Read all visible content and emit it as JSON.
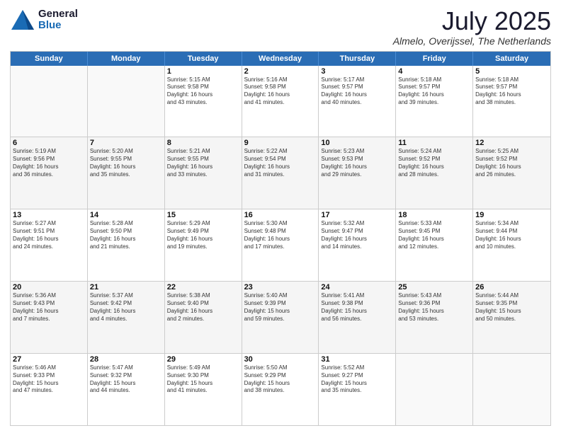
{
  "logo": {
    "general": "General",
    "blue": "Blue"
  },
  "title": "July 2025",
  "subtitle": "Almelo, Overijssel, The Netherlands",
  "header_days": [
    "Sunday",
    "Monday",
    "Tuesday",
    "Wednesday",
    "Thursday",
    "Friday",
    "Saturday"
  ],
  "rows": [
    [
      {
        "day": "",
        "lines": [],
        "empty": true
      },
      {
        "day": "",
        "lines": [],
        "empty": true
      },
      {
        "day": "1",
        "lines": [
          "Sunrise: 5:15 AM",
          "Sunset: 9:58 PM",
          "Daylight: 16 hours",
          "and 43 minutes."
        ]
      },
      {
        "day": "2",
        "lines": [
          "Sunrise: 5:16 AM",
          "Sunset: 9:58 PM",
          "Daylight: 16 hours",
          "and 41 minutes."
        ]
      },
      {
        "day": "3",
        "lines": [
          "Sunrise: 5:17 AM",
          "Sunset: 9:57 PM",
          "Daylight: 16 hours",
          "and 40 minutes."
        ]
      },
      {
        "day": "4",
        "lines": [
          "Sunrise: 5:18 AM",
          "Sunset: 9:57 PM",
          "Daylight: 16 hours",
          "and 39 minutes."
        ]
      },
      {
        "day": "5",
        "lines": [
          "Sunrise: 5:18 AM",
          "Sunset: 9:57 PM",
          "Daylight: 16 hours",
          "and 38 minutes."
        ]
      }
    ],
    [
      {
        "day": "6",
        "lines": [
          "Sunrise: 5:19 AM",
          "Sunset: 9:56 PM",
          "Daylight: 16 hours",
          "and 36 minutes."
        ]
      },
      {
        "day": "7",
        "lines": [
          "Sunrise: 5:20 AM",
          "Sunset: 9:55 PM",
          "Daylight: 16 hours",
          "and 35 minutes."
        ]
      },
      {
        "day": "8",
        "lines": [
          "Sunrise: 5:21 AM",
          "Sunset: 9:55 PM",
          "Daylight: 16 hours",
          "and 33 minutes."
        ]
      },
      {
        "day": "9",
        "lines": [
          "Sunrise: 5:22 AM",
          "Sunset: 9:54 PM",
          "Daylight: 16 hours",
          "and 31 minutes."
        ]
      },
      {
        "day": "10",
        "lines": [
          "Sunrise: 5:23 AM",
          "Sunset: 9:53 PM",
          "Daylight: 16 hours",
          "and 29 minutes."
        ]
      },
      {
        "day": "11",
        "lines": [
          "Sunrise: 5:24 AM",
          "Sunset: 9:52 PM",
          "Daylight: 16 hours",
          "and 28 minutes."
        ]
      },
      {
        "day": "12",
        "lines": [
          "Sunrise: 5:25 AM",
          "Sunset: 9:52 PM",
          "Daylight: 16 hours",
          "and 26 minutes."
        ]
      }
    ],
    [
      {
        "day": "13",
        "lines": [
          "Sunrise: 5:27 AM",
          "Sunset: 9:51 PM",
          "Daylight: 16 hours",
          "and 24 minutes."
        ]
      },
      {
        "day": "14",
        "lines": [
          "Sunrise: 5:28 AM",
          "Sunset: 9:50 PM",
          "Daylight: 16 hours",
          "and 21 minutes."
        ]
      },
      {
        "day": "15",
        "lines": [
          "Sunrise: 5:29 AM",
          "Sunset: 9:49 PM",
          "Daylight: 16 hours",
          "and 19 minutes."
        ]
      },
      {
        "day": "16",
        "lines": [
          "Sunrise: 5:30 AM",
          "Sunset: 9:48 PM",
          "Daylight: 16 hours",
          "and 17 minutes."
        ]
      },
      {
        "day": "17",
        "lines": [
          "Sunrise: 5:32 AM",
          "Sunset: 9:47 PM",
          "Daylight: 16 hours",
          "and 14 minutes."
        ]
      },
      {
        "day": "18",
        "lines": [
          "Sunrise: 5:33 AM",
          "Sunset: 9:45 PM",
          "Daylight: 16 hours",
          "and 12 minutes."
        ]
      },
      {
        "day": "19",
        "lines": [
          "Sunrise: 5:34 AM",
          "Sunset: 9:44 PM",
          "Daylight: 16 hours",
          "and 10 minutes."
        ]
      }
    ],
    [
      {
        "day": "20",
        "lines": [
          "Sunrise: 5:36 AM",
          "Sunset: 9:43 PM",
          "Daylight: 16 hours",
          "and 7 minutes."
        ]
      },
      {
        "day": "21",
        "lines": [
          "Sunrise: 5:37 AM",
          "Sunset: 9:42 PM",
          "Daylight: 16 hours",
          "and 4 minutes."
        ]
      },
      {
        "day": "22",
        "lines": [
          "Sunrise: 5:38 AM",
          "Sunset: 9:40 PM",
          "Daylight: 16 hours",
          "and 2 minutes."
        ]
      },
      {
        "day": "23",
        "lines": [
          "Sunrise: 5:40 AM",
          "Sunset: 9:39 PM",
          "Daylight: 15 hours",
          "and 59 minutes."
        ]
      },
      {
        "day": "24",
        "lines": [
          "Sunrise: 5:41 AM",
          "Sunset: 9:38 PM",
          "Daylight: 15 hours",
          "and 56 minutes."
        ]
      },
      {
        "day": "25",
        "lines": [
          "Sunrise: 5:43 AM",
          "Sunset: 9:36 PM",
          "Daylight: 15 hours",
          "and 53 minutes."
        ]
      },
      {
        "day": "26",
        "lines": [
          "Sunrise: 5:44 AM",
          "Sunset: 9:35 PM",
          "Daylight: 15 hours",
          "and 50 minutes."
        ]
      }
    ],
    [
      {
        "day": "27",
        "lines": [
          "Sunrise: 5:46 AM",
          "Sunset: 9:33 PM",
          "Daylight: 15 hours",
          "and 47 minutes."
        ]
      },
      {
        "day": "28",
        "lines": [
          "Sunrise: 5:47 AM",
          "Sunset: 9:32 PM",
          "Daylight: 15 hours",
          "and 44 minutes."
        ]
      },
      {
        "day": "29",
        "lines": [
          "Sunrise: 5:49 AM",
          "Sunset: 9:30 PM",
          "Daylight: 15 hours",
          "and 41 minutes."
        ]
      },
      {
        "day": "30",
        "lines": [
          "Sunrise: 5:50 AM",
          "Sunset: 9:29 PM",
          "Daylight: 15 hours",
          "and 38 minutes."
        ]
      },
      {
        "day": "31",
        "lines": [
          "Sunrise: 5:52 AM",
          "Sunset: 9:27 PM",
          "Daylight: 15 hours",
          "and 35 minutes."
        ]
      },
      {
        "day": "",
        "lines": [],
        "empty": true
      },
      {
        "day": "",
        "lines": [],
        "empty": true
      }
    ]
  ]
}
